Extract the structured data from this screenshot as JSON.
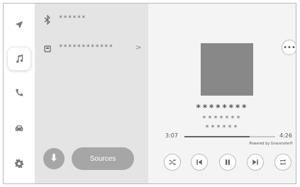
{
  "rail": {
    "items": [
      {
        "name": "navigation"
      },
      {
        "name": "audio",
        "active": true
      },
      {
        "name": "phone"
      },
      {
        "name": "vehicle"
      },
      {
        "name": "settings"
      }
    ]
  },
  "sources": {
    "items": [
      {
        "icon": "bluetooth-icon",
        "label": "******"
      },
      {
        "icon": "usb-device-icon",
        "label": "************",
        "chevron": ">"
      }
    ],
    "sources_button_label": "Sources"
  },
  "player": {
    "more_label": "•••",
    "title": "********",
    "artist": "*******",
    "album": "******",
    "elapsed": "3:07",
    "total": "4:26",
    "progress_fraction": 0.72,
    "powered_by": "Powered by Gracenote®"
  },
  "colors": {
    "accent_gray": "#a6a6a6",
    "album_art": "#888888"
  }
}
